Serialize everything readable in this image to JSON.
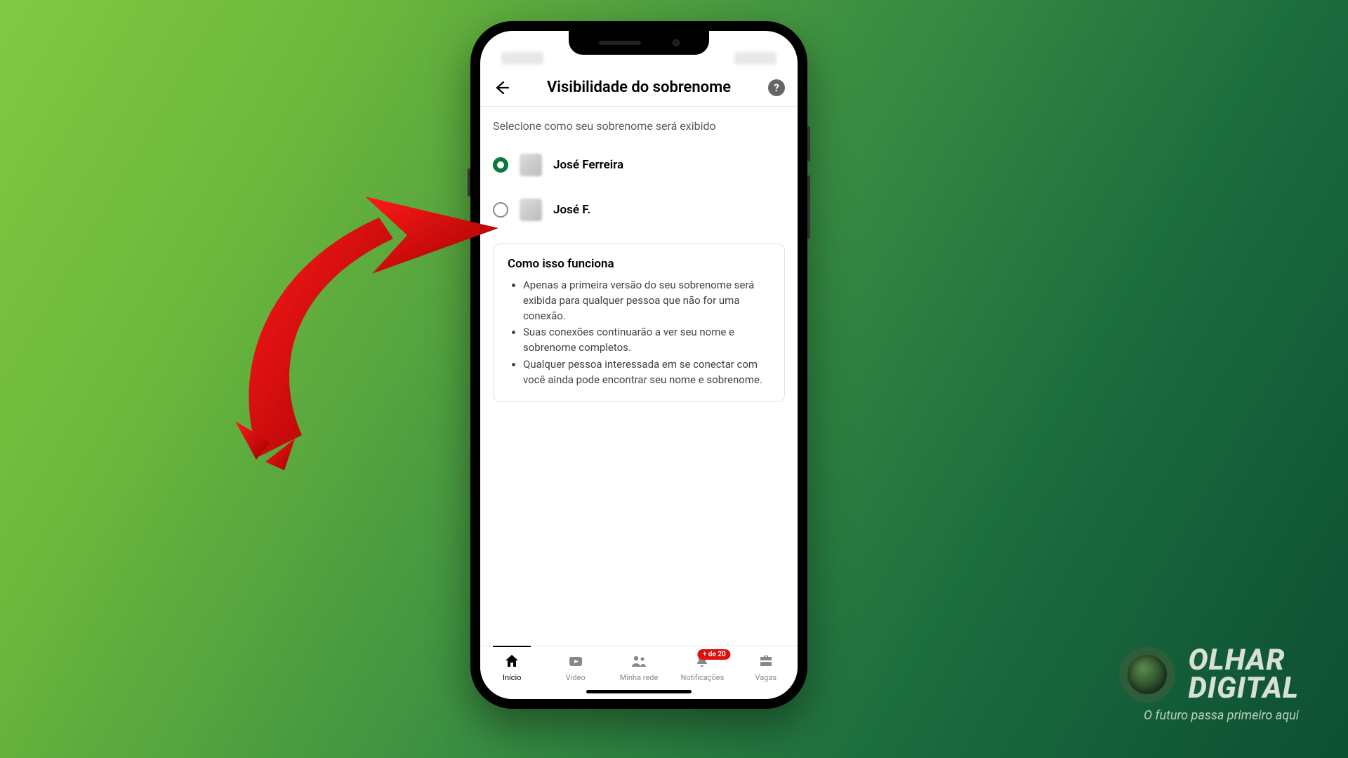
{
  "header": {
    "title": "Visibilidade do sobrenome"
  },
  "subtitle": "Selecione como seu sobrenome será exibido",
  "options": [
    {
      "label": "José Ferreira",
      "selected": true
    },
    {
      "label": "José F.",
      "selected": false
    }
  ],
  "info": {
    "title": "Como isso funciona",
    "bullets": [
      "Apenas a primeira versão do seu sobrenome será exibida para qualquer pessoa que não for uma conexão.",
      "Suas conexões continuarão a ver seu nome e sobrenome completos.",
      "Qualquer pessoa interessada em se conectar com você ainda pode encontrar seu nome e sobrenome."
    ]
  },
  "nav": {
    "items": [
      {
        "label": "Início",
        "icon": "home",
        "active": true
      },
      {
        "label": "Vídeo",
        "icon": "video"
      },
      {
        "label": "Minha rede",
        "icon": "network"
      },
      {
        "label": "Notificações",
        "icon": "bell",
        "badge": "+ de 20"
      },
      {
        "label": "Vagas",
        "icon": "jobs"
      }
    ]
  },
  "brand": {
    "name_line1": "OLHAR",
    "name_line2": "DIGITAL",
    "tagline": "O futuro passa primeiro aqui"
  }
}
